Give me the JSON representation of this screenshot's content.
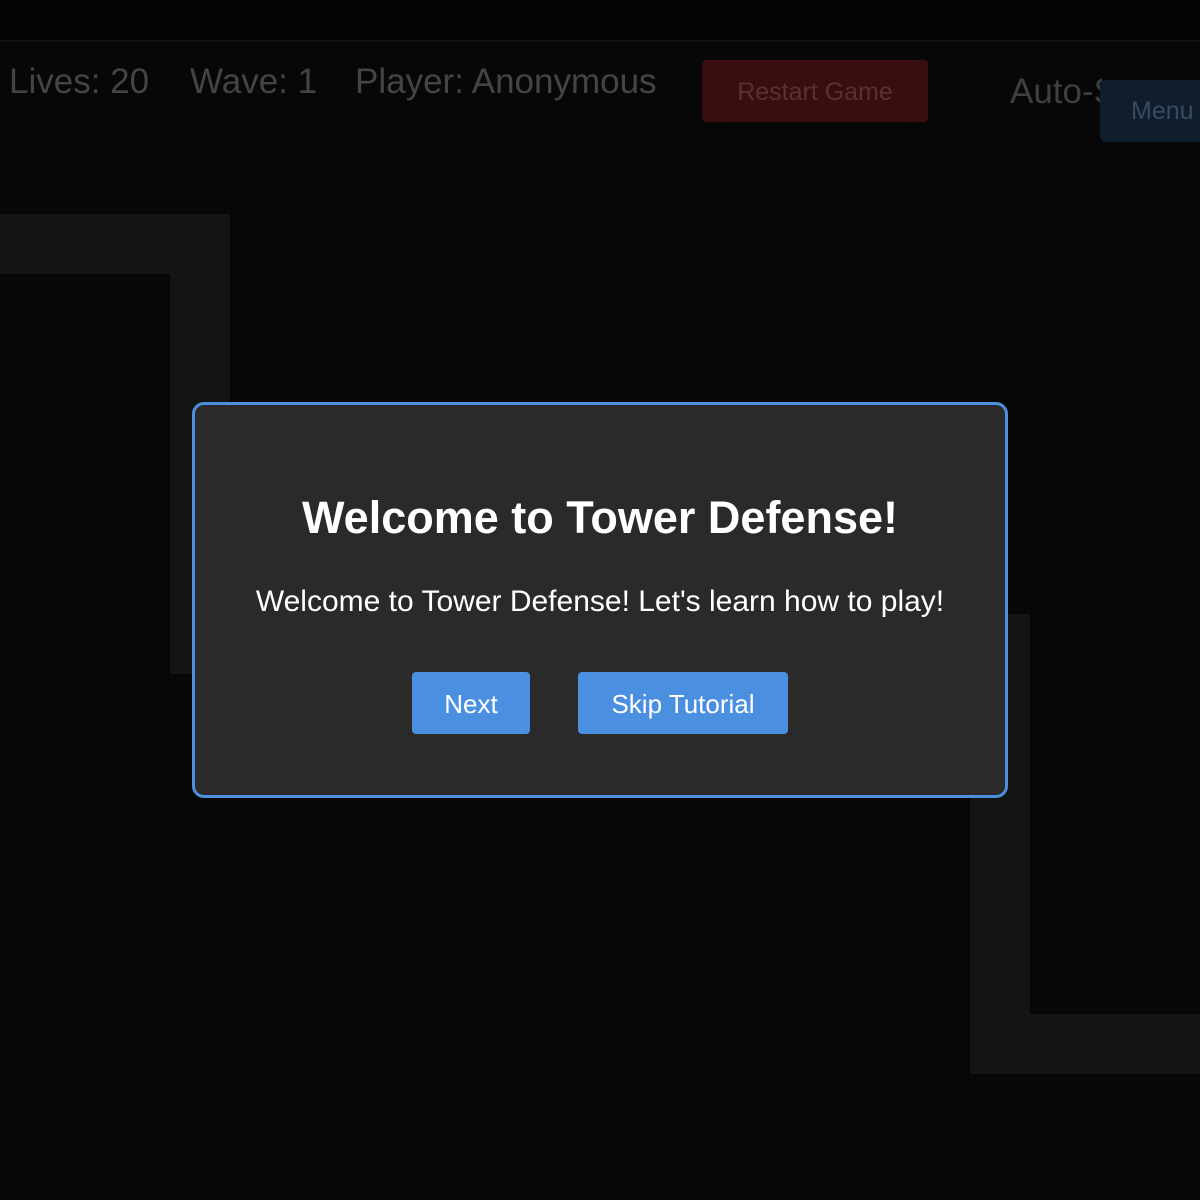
{
  "hud": {
    "lives": "Lives: 20",
    "wave": "Wave: 1",
    "player": "Player: Anonymous",
    "restart_label": "Restart Game",
    "autostart_label": "Auto-Start",
    "menu_label": "Menu"
  },
  "tutorial": {
    "title": "Welcome to Tower Defense!",
    "message": "Welcome to Tower Defense! Let's learn how to play!",
    "next_label": "Next",
    "skip_label": "Skip Tutorial"
  },
  "colors": {
    "accent": "#4a8fe0",
    "modal_background": "#2a2a2a",
    "restart": "#3a0e0e",
    "path": "#141414"
  }
}
